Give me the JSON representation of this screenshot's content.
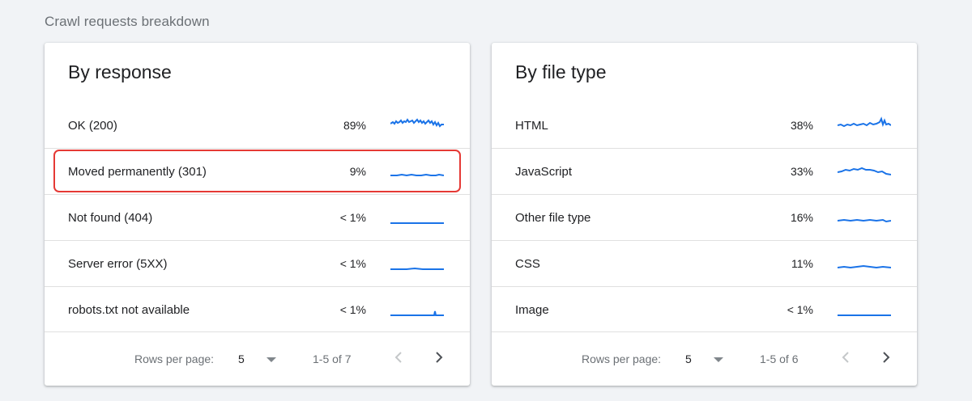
{
  "section": {
    "title": "Crawl requests breakdown"
  },
  "cards": {
    "left": {
      "title": "By response",
      "rows": [
        {
          "label": "OK (200)",
          "pct": "89%",
          "spark": "high-wavy"
        },
        {
          "label": "Moved permanently (301)",
          "pct": "9%",
          "spark": "low-flat"
        },
        {
          "label": "Not found (404)",
          "pct": "< 1%",
          "spark": "flat"
        },
        {
          "label": "Server error (5XX)",
          "pct": "< 1%",
          "spark": "flat"
        },
        {
          "label": "robots.txt not available",
          "pct": "< 1%",
          "spark": "flat-spike"
        }
      ],
      "footer": {
        "rows_per_page_label": "Rows per page:",
        "rows_per_page_value": "5",
        "range": "1-5 of 7"
      }
    },
    "right": {
      "title": "By file type",
      "rows": [
        {
          "label": "HTML",
          "pct": "38%",
          "spark": "wavy-spike"
        },
        {
          "label": "JavaScript",
          "pct": "33%",
          "spark": "hump"
        },
        {
          "label": "Other file type",
          "pct": "16%",
          "spark": "low-wavy"
        },
        {
          "label": "CSS",
          "pct": "11%",
          "spark": "low-wavy"
        },
        {
          "label": "Image",
          "pct": "< 1%",
          "spark": "flat"
        }
      ],
      "footer": {
        "rows_per_page_label": "Rows per page:",
        "rows_per_page_value": "5",
        "range": "1-5 of 6"
      }
    }
  },
  "colors": {
    "spark_line": "#1a73e8",
    "highlight_border": "#e53935",
    "background": "#f1f3f6"
  },
  "icons": {
    "dropdown": "caret-down-icon",
    "prev": "chevron-left-icon",
    "next": "chevron-right-icon"
  }
}
